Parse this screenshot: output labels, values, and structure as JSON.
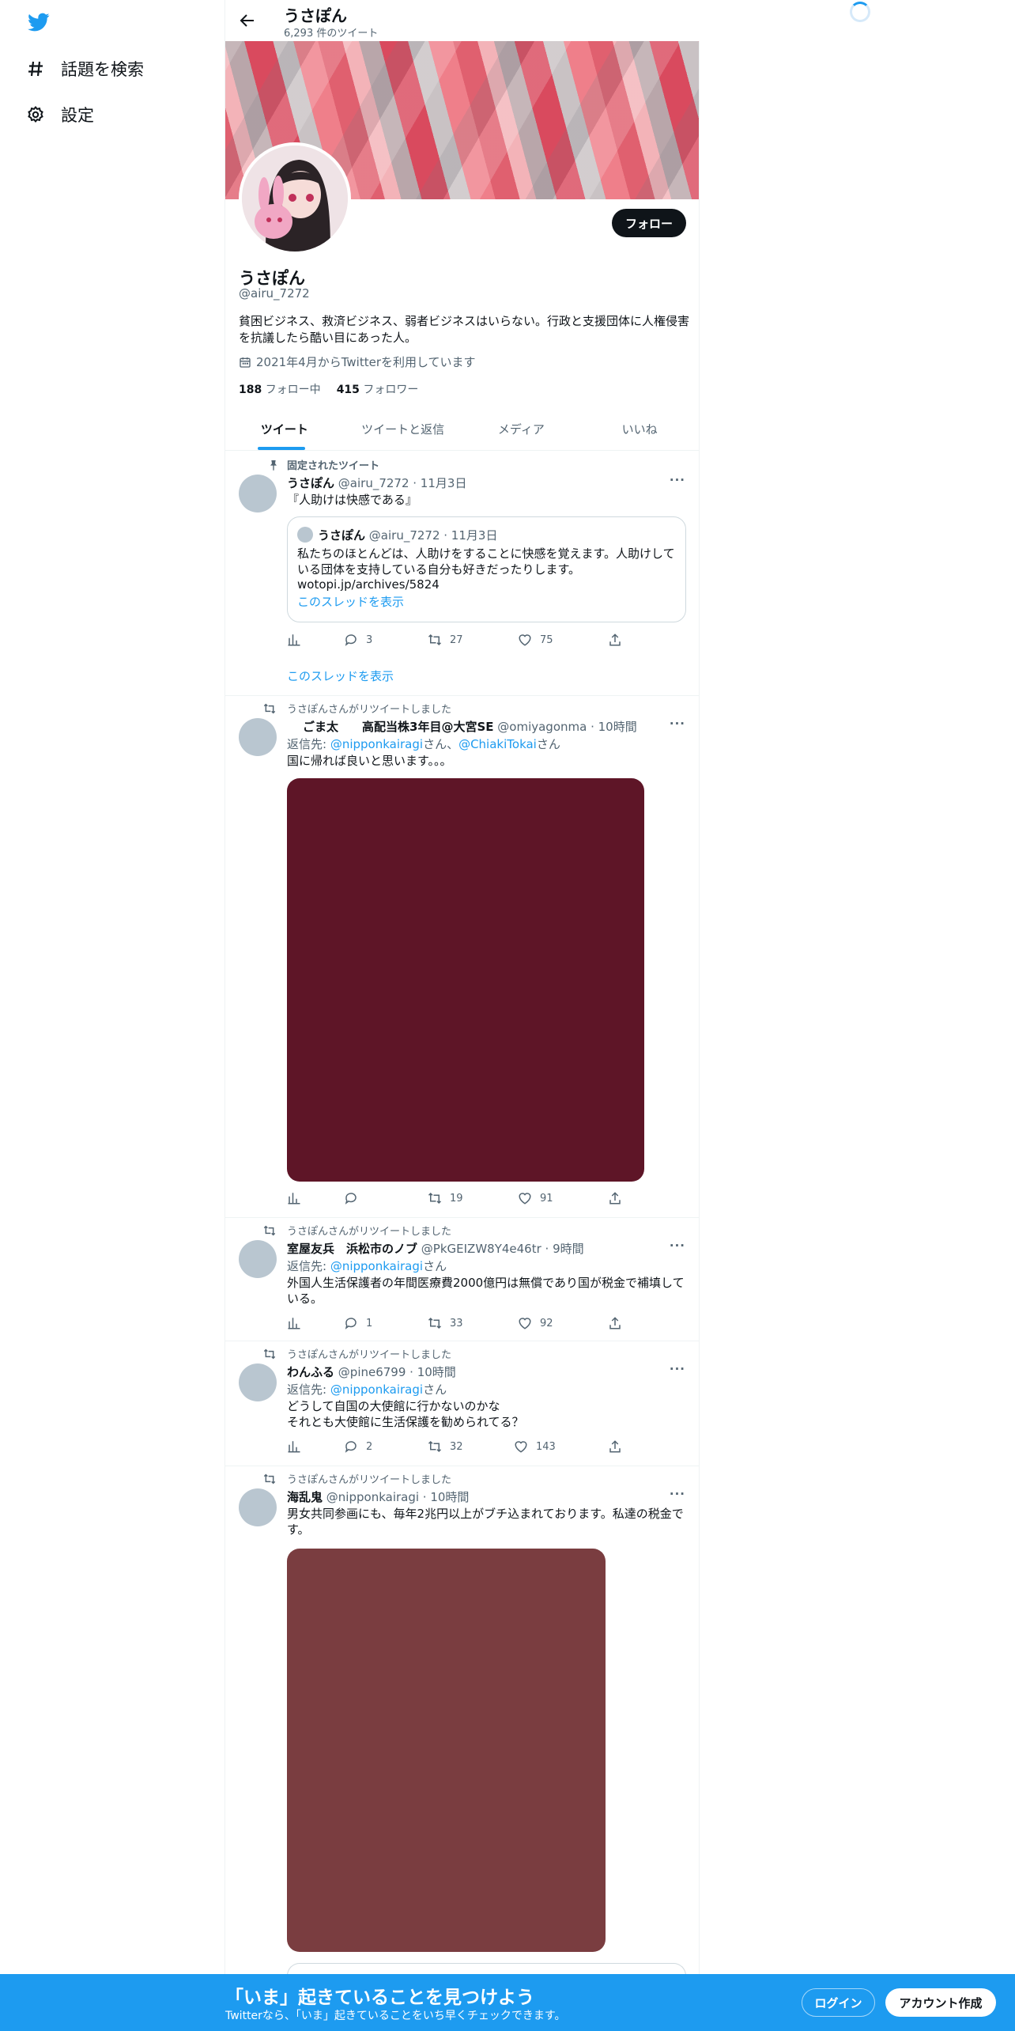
{
  "sidebar": {
    "items": [
      {
        "label": "話題を検索",
        "icon": "hashtag-icon"
      },
      {
        "label": "設定",
        "icon": "gear-icon"
      }
    ]
  },
  "header": {
    "title": "うさぽん",
    "tweet_count": "6,293 件のツイート"
  },
  "profile": {
    "name": "うさぽん",
    "handle": "@airu_7272",
    "follow_label": "フォロー",
    "bio": "貧困ビジネス、救済ビジネス、弱者ビジネスはいらない。行政と支援団体に人権侵害を抗議したら酷い目にあった人。",
    "joined": "2021年4月からTwitterを利用しています",
    "following_count": "188",
    "following_label": "フォロー中",
    "followers_count": "415",
    "followers_label": "フォロワー"
  },
  "tabs": [
    "ツイート",
    "ツイートと返信",
    "メディア",
    "いいね"
  ],
  "tweets": [
    {
      "context": "固定されたツイート",
      "name": "うさぽん",
      "meta": "@airu_7272 · 11月3日",
      "text": "『人助けは快感である』",
      "quote": {
        "name": "うさぽん",
        "meta": "@airu_7272 · 11月3日",
        "text": "私たちのほとんどは、人助けをすることに快感を覚えます。人助けしている団体を支持している自分も好きだったりします。",
        "url": "wotopi.jp/archives/5824",
        "thread": "このスレッドを表示"
      },
      "replies": "3",
      "retweets": "27",
      "likes": "75",
      "show_thread": "このスレッドを表示"
    },
    {
      "context": "うさぽんさんがリツイートしました",
      "name": "ごま太　　高配当株3年目@大宮SE",
      "meta": "@omiyagonma · 10時間",
      "reply_prefix": "返信先: ",
      "reply_to_1": "@nipponkairagi",
      "reply_mid": "さん、",
      "reply_to_2": "@ChiakiTokai",
      "reply_suffix": "さん",
      "text": "国に帰れば良いと思います。。。",
      "media_color": "#5e1527",
      "replies": "",
      "retweets": "19",
      "likes": "91"
    },
    {
      "context": "うさぽんさんがリツイートしました",
      "name": "室屋友兵　浜松市のノブ",
      "meta": "@PkGEIZW8Y4e46tr · 9時間",
      "reply_prefix": "返信先: ",
      "reply_to_1": "@nipponkairagi",
      "reply_suffix": "さん",
      "text": "外国人生活保護者の年間医療費2000億円は無償であり国が税金で補填している。",
      "replies": "1",
      "retweets": "33",
      "likes": "92"
    },
    {
      "context": "うさぽんさんがリツイートしました",
      "name": "わんふる",
      "meta": "@pine6799 · 10時間",
      "reply_prefix": "返信先: ",
      "reply_to_1": "@nipponkairagi",
      "reply_suffix": "さん",
      "text": "どうして自国の大使館に行かないのかな\nそれとも大使館に生活保護を勧められてる？",
      "replies": "2",
      "retweets": "32",
      "likes": "143"
    },
    {
      "context": "うさぽんさんがリツイートしました",
      "name": "海乱鬼",
      "meta": "@nipponkairagi · 10時間",
      "text": "男女共同参画にも、毎年2兆円以上がブチ込まれております。私達の税金です。",
      "media_color": "#7a3d40"
    }
  ],
  "bottom_bar": {
    "title": "「いま」起きていることを見つけよう",
    "subtitle": "Twitterなら、「いま」起きていることをいち早くチェックできます。",
    "login": "ログイン",
    "signup": "アカウント作成"
  },
  "colors": {
    "accent": "#1d9bf0",
    "text": "#0f1419",
    "secondary": "#536471"
  }
}
